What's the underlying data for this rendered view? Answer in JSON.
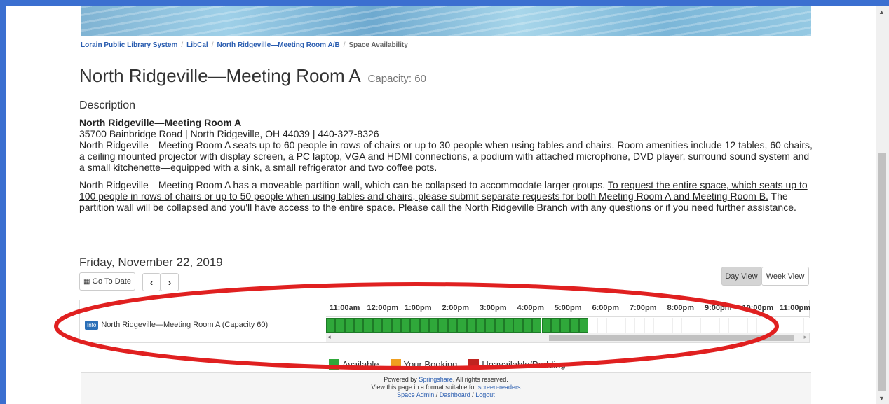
{
  "breadcrumb": [
    {
      "label": "Lorain Public Library System",
      "link": true
    },
    {
      "label": "LibCal",
      "link": true
    },
    {
      "label": "North Ridgeville—Meeting Room A/B",
      "link": true
    },
    {
      "label": "Space Availability",
      "link": false
    }
  ],
  "room": {
    "title": "North Ridgeville—Meeting Room A",
    "capacity_label": "Capacity: 60"
  },
  "description": {
    "heading": "Description",
    "name": "North Ridgeville—Meeting Room A",
    "address": "35700 Bainbridge Road | North Ridgeville, OH 44039 | 440-327-8326",
    "para1": "North Ridgeville—Meeting Room A seats up to 60 people in rows of chairs or up to 30 people when using tables and chairs. Room amenities include 12 tables, 60 chairs, a ceiling mounted projector with display screen, a PC laptop, VGA and HDMI connections, a podium with attached microphone, DVD player, surround sound system and a small kitchenette—equipped with a sink, a small refrigerator and two coffee pots.",
    "para2_start": "North Ridgeville—Meeting Room A has a moveable partition wall, which can be collapsed to accommodate larger groups. ",
    "para2_underlined": "To request the entire space, which seats up to 100 people in rows of chairs or up to 50 people when using tables and chairs, please submit separate requests for both Meeting Room A and Meeting Room B.",
    "para2_end": " The partition wall will be collapsed and you'll have access to the entire space. Please call the North Ridgeville Branch with any questions or if you need further assistance."
  },
  "calendar": {
    "date": "Friday, November 22, 2019",
    "goto_label": "Go To Date",
    "prev_glyph": "‹",
    "next_glyph": "›",
    "day_view": "Day View",
    "week_view": "Week View",
    "hours": [
      "11:00am",
      "12:00pm",
      "1:00pm",
      "2:00pm",
      "3:00pm",
      "4:00pm",
      "5:00pm",
      "6:00pm",
      "7:00pm",
      "8:00pm",
      "9:00pm",
      "10:00pm",
      "11:00pm"
    ],
    "row_info": "Info",
    "row_label": "North Ridgeville—Meeting Room A (Capacity 60)",
    "available_slots": 28,
    "empty_slots": 24
  },
  "legend": [
    {
      "label": "Available",
      "color": "#2fa83a"
    },
    {
      "label": "Your Booking",
      "color": "#f0a020"
    },
    {
      "label": "Unavailable/Padding",
      "color": "#c0231f"
    }
  ],
  "footer": {
    "powered_prefix": "Powered by ",
    "powered_link": "Springshare",
    "powered_suffix": ". All rights reserved.",
    "view_prefix": "View this page in a format suitable for ",
    "view_link": "screen-readers",
    "admin": "Space Admin",
    "dashboard": "Dashboard",
    "logout": "Logout"
  },
  "annotation_color": "#e02020"
}
